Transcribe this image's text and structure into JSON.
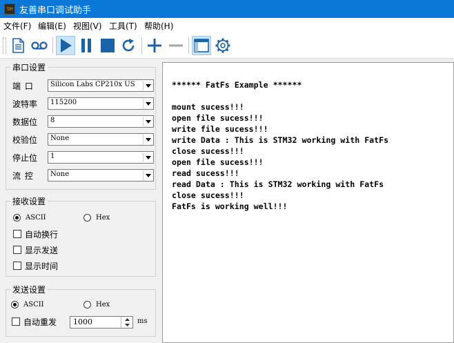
{
  "window": {
    "title": "友善串口调试助手",
    "icon_label": "SH"
  },
  "menu": [
    {
      "label": "文件(F)"
    },
    {
      "label": "编辑(E)"
    },
    {
      "label": "视图(V)"
    },
    {
      "label": "工具(T)"
    },
    {
      "label": "帮助(H)"
    }
  ],
  "toolbar": {
    "icons": [
      "new-file-icon",
      "loop-icon",
      "play-icon",
      "pause-icon",
      "stop-icon",
      "refresh-icon",
      "add-icon",
      "remove-icon",
      "window-icon",
      "settings-icon"
    ],
    "accent": "#1b63a8"
  },
  "serial_settings": {
    "title": "串口设置",
    "fields": [
      {
        "label": "端  口",
        "value": "Silicon Labs CP210x US"
      },
      {
        "label": "波特率",
        "value": "115200"
      },
      {
        "label": "数据位",
        "value": "8"
      },
      {
        "label": "校验位",
        "value": "None"
      },
      {
        "label": "停止位",
        "value": "1"
      },
      {
        "label": "流  控",
        "value": "None"
      }
    ]
  },
  "receive_settings": {
    "title": "接收设置",
    "ascii_label": "ASCII",
    "hex_label": "Hex",
    "selected": "ASCII",
    "checks": [
      {
        "label": "自动换行",
        "checked": false
      },
      {
        "label": "显示发送",
        "checked": false
      },
      {
        "label": "显示时间",
        "checked": false
      }
    ]
  },
  "send_settings": {
    "title": "发送设置",
    "ascii_label": "ASCII",
    "hex_label": "Hex",
    "selected": "ASCII",
    "auto_resend_label": "自动重发",
    "auto_resend_checked": false,
    "interval": "1000",
    "unit": "ms"
  },
  "output": {
    "text": "****** FatFs Example ******\n\nmount sucess!!!\nopen file sucess!!!\nwrite file sucess!!!\nwrite Data : This is STM32 working with FatFs\nclose sucess!!!\nopen file sucess!!!\nread sucess!!!\nread Data : This is STM32 working with FatFs\nclose sucess!!!\nFatFs is working well!!!"
  }
}
